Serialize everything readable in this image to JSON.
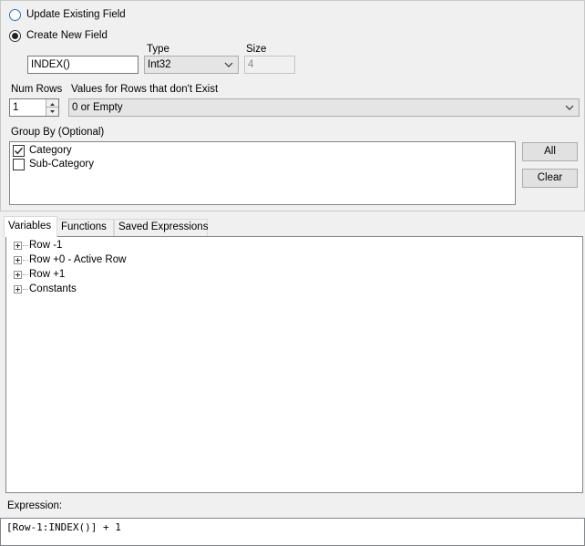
{
  "field_mode": {
    "update_existing_label": "Update Existing Field",
    "update_existing_checked": false,
    "create_new_label": "Create New  Field",
    "create_new_checked": true
  },
  "new_field": {
    "name_value": "INDEX()",
    "type_label": "Type",
    "type_value": "Int32",
    "size_label": "Size",
    "size_value": "4"
  },
  "num_rows": {
    "label": "Num Rows",
    "value": "1"
  },
  "nonexistent_rows": {
    "label": "Values for Rows that don't Exist",
    "value": "0 or Empty"
  },
  "group_by": {
    "label": "Group By (Optional)",
    "items": [
      {
        "label": "Category",
        "checked": true
      },
      {
        "label": "Sub-Category",
        "checked": false
      }
    ],
    "all_button": "All",
    "clear_button": "Clear"
  },
  "tabs": [
    {
      "label": "Variables",
      "active": true
    },
    {
      "label": "Functions",
      "active": false
    },
    {
      "label": "Saved Expressions",
      "active": false
    }
  ],
  "tree": {
    "items": [
      {
        "label": "Row -1"
      },
      {
        "label": "Row +0 - Active Row"
      },
      {
        "label": "Row +1"
      },
      {
        "label": "Constants"
      }
    ]
  },
  "expression": {
    "label": "Expression:",
    "value": "[Row-1:INDEX()] + 1"
  }
}
